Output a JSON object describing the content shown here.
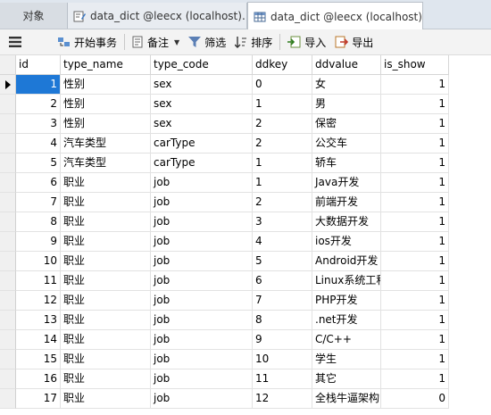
{
  "tabs": [
    {
      "label": "对象"
    },
    {
      "label": "data_dict @leecx (localhost)..."
    },
    {
      "label": "data_dict @leecx (localhost)..."
    }
  ],
  "toolbar": {
    "begin_transaction": "开始事务",
    "note": "备注",
    "filter": "筛选",
    "sort": "排序",
    "import": "导入",
    "export": "导出"
  },
  "columns": [
    "id",
    "type_name",
    "type_code",
    "ddkey",
    "ddvalue",
    "is_show"
  ],
  "rows": [
    {
      "id": "1",
      "type_name": "性别",
      "type_code": "sex",
      "ddkey": "0",
      "ddvalue": "女",
      "is_show": "1"
    },
    {
      "id": "2",
      "type_name": "性别",
      "type_code": "sex",
      "ddkey": "1",
      "ddvalue": "男",
      "is_show": "1"
    },
    {
      "id": "3",
      "type_name": "性别",
      "type_code": "sex",
      "ddkey": "2",
      "ddvalue": "保密",
      "is_show": "1"
    },
    {
      "id": "4",
      "type_name": "汽车类型",
      "type_code": "carType",
      "ddkey": "2",
      "ddvalue": "公交车",
      "is_show": "1"
    },
    {
      "id": "5",
      "type_name": "汽车类型",
      "type_code": "carType",
      "ddkey": "1",
      "ddvalue": "轿车",
      "is_show": "1"
    },
    {
      "id": "6",
      "type_name": "职业",
      "type_code": "job",
      "ddkey": "1",
      "ddvalue": "Java开发",
      "is_show": "1"
    },
    {
      "id": "7",
      "type_name": "职业",
      "type_code": "job",
      "ddkey": "2",
      "ddvalue": "前端开发",
      "is_show": "1"
    },
    {
      "id": "8",
      "type_name": "职业",
      "type_code": "job",
      "ddkey": "3",
      "ddvalue": "大数据开发",
      "is_show": "1"
    },
    {
      "id": "9",
      "type_name": "职业",
      "type_code": "job",
      "ddkey": "4",
      "ddvalue": "ios开发",
      "is_show": "1"
    },
    {
      "id": "10",
      "type_name": "职业",
      "type_code": "job",
      "ddkey": "5",
      "ddvalue": "Android开发",
      "is_show": "1"
    },
    {
      "id": "11",
      "type_name": "职业",
      "type_code": "job",
      "ddkey": "6",
      "ddvalue": "Linux系统工程",
      "is_show": "1"
    },
    {
      "id": "12",
      "type_name": "职业",
      "type_code": "job",
      "ddkey": "7",
      "ddvalue": "PHP开发",
      "is_show": "1"
    },
    {
      "id": "13",
      "type_name": "职业",
      "type_code": "job",
      "ddkey": "8",
      "ddvalue": ".net开发",
      "is_show": "1"
    },
    {
      "id": "14",
      "type_name": "职业",
      "type_code": "job",
      "ddkey": "9",
      "ddvalue": "C/C++",
      "is_show": "1"
    },
    {
      "id": "15",
      "type_name": "职业",
      "type_code": "job",
      "ddkey": "10",
      "ddvalue": "学生",
      "is_show": "1"
    },
    {
      "id": "16",
      "type_name": "职业",
      "type_code": "job",
      "ddkey": "11",
      "ddvalue": "其它",
      "is_show": "1"
    },
    {
      "id": "17",
      "type_name": "职业",
      "type_code": "job",
      "ddkey": "12",
      "ddvalue": "全栈牛逼架构",
      "is_show": "0"
    }
  ],
  "selected_row": 0,
  "icons": {
    "query_tab": "query-edit-icon",
    "table_tab": "table-grid-icon",
    "menu": "hamburger-menu-icon",
    "begin_transaction": "transaction-icon",
    "note": "note-icon",
    "filter": "funnel-icon",
    "sort": "sort-icon",
    "import": "import-icon",
    "export": "export-icon"
  },
  "colors": {
    "selection": "#1e78d6",
    "tabbar": "#dfe6ee",
    "toolbar": "#f3f3f3"
  }
}
